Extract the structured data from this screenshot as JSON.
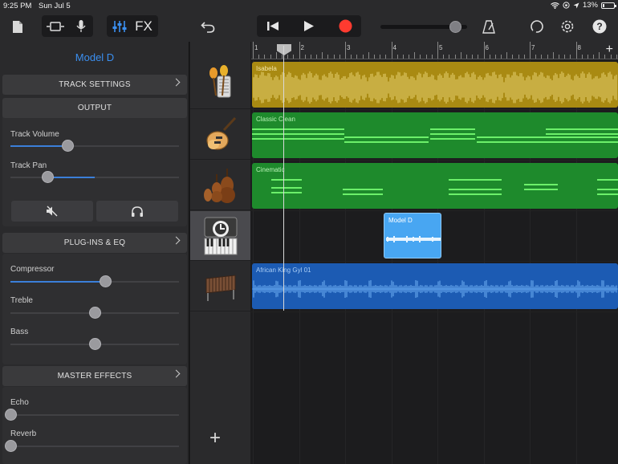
{
  "status": {
    "time": "9:25 PM",
    "date": "Sun Jul 5",
    "battery": "13%",
    "battery_level": 0.13
  },
  "toolbar": {
    "fx_label": "FX",
    "master_volume": 0.9
  },
  "inspector": {
    "title": "Model D",
    "track_settings": "TRACK SETTINGS",
    "output": {
      "header": "OUTPUT",
      "volume_label": "Track Volume",
      "volume_value": 0.34,
      "pan_label": "Track Pan",
      "pan_value": 0.22
    },
    "plugins": {
      "header": "PLUG-INS & EQ",
      "compressor_label": "Compressor",
      "compressor_value": 0.56,
      "treble_label": "Treble",
      "treble_value": 0.5,
      "bass_label": "Bass",
      "bass_value": 0.5
    },
    "master": {
      "header": "MASTER EFFECTS",
      "echo_label": "Echo",
      "echo_value": 0.0,
      "reverb_label": "Reverb",
      "reverb_value": 0.0
    }
  },
  "ruler": {
    "bars": [
      "1",
      "2",
      "3",
      "4",
      "5",
      "6",
      "7",
      "8"
    ]
  },
  "tracks": [
    {
      "icon": "drum-kit-icon",
      "region": "Isabela",
      "color": "#a98a12"
    },
    {
      "icon": "electric-guitar-icon",
      "region": "Classic Clean",
      "color": "#1f8f2f"
    },
    {
      "icon": "strings-icon",
      "region": "Cinematic",
      "color": "#1f8f2f"
    },
    {
      "icon": "synthesizer-icon",
      "region": "Model D",
      "color": "#48a6f2"
    },
    {
      "icon": "marimba-icon",
      "region": "African King Gyl 01",
      "color": "#1c5bb3"
    }
  ]
}
